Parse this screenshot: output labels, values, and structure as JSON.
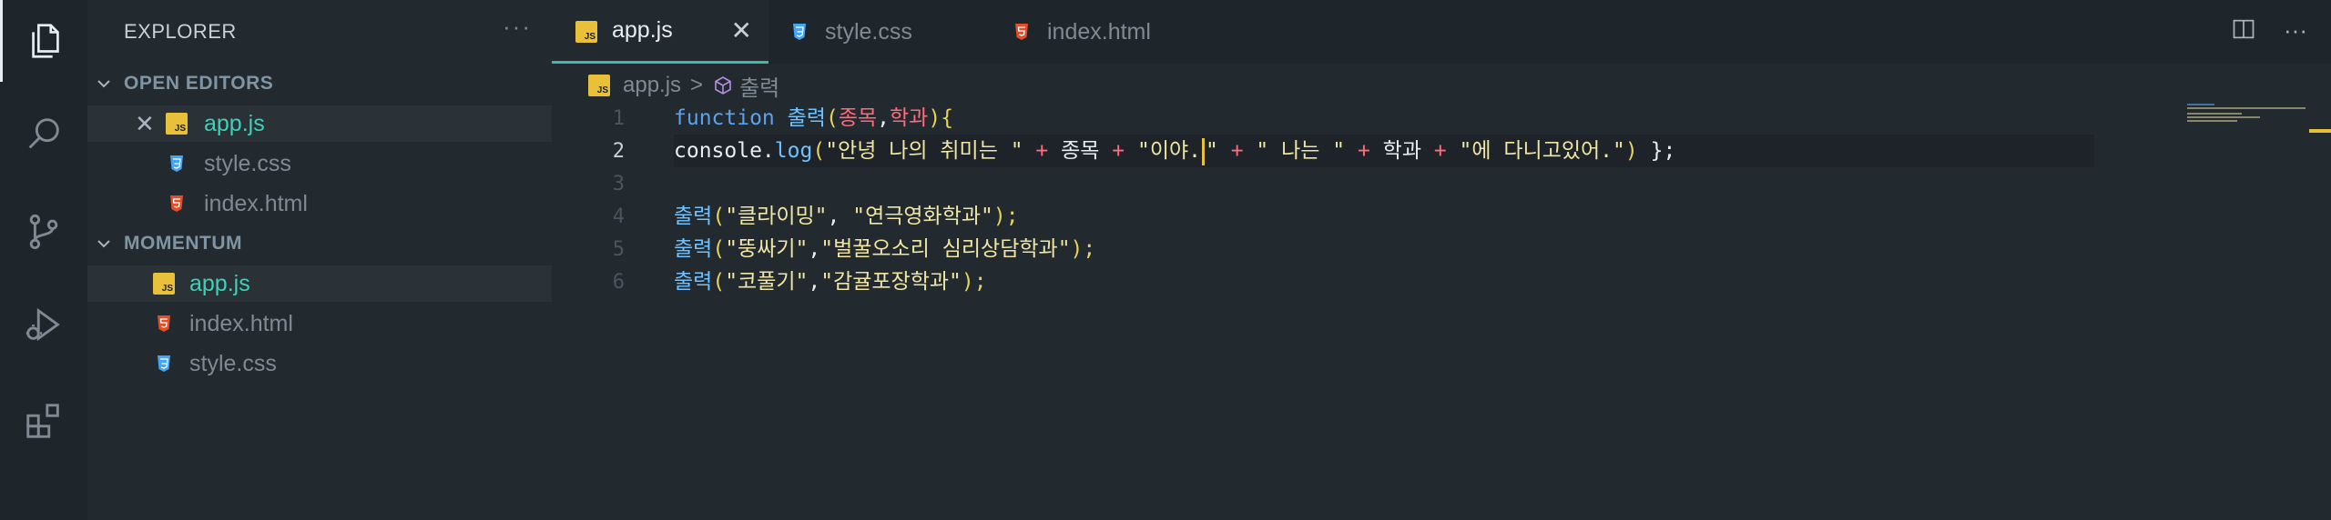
{
  "activity_bar": {
    "items": [
      "explorer-icon",
      "search-icon",
      "source-control-icon",
      "run-debug-icon",
      "extensions-icon"
    ]
  },
  "sidebar": {
    "title": "EXPLORER",
    "more": "···",
    "open_editors": {
      "title": "OPEN EDITORS",
      "files": [
        {
          "name": "app.js",
          "type": "js",
          "close": "✕"
        },
        {
          "name": "style.css",
          "type": "css"
        },
        {
          "name": "index.html",
          "type": "html"
        }
      ]
    },
    "project": {
      "title": "MOMENTUM",
      "files": [
        {
          "name": "app.js",
          "type": "js"
        },
        {
          "name": "index.html",
          "type": "html"
        },
        {
          "name": "style.css",
          "type": "css"
        }
      ]
    }
  },
  "tabs": [
    {
      "label": "app.js",
      "type": "js",
      "close": "✕"
    },
    {
      "label": "style.css",
      "type": "css"
    },
    {
      "label": "index.html",
      "type": "html"
    }
  ],
  "tab_actions": {
    "split": "split-editor-icon",
    "more": "···"
  },
  "breadcrumb": {
    "file": "app.js",
    "sep": ">",
    "symbol": "출력"
  },
  "editor": {
    "line_numbers": [
      "1",
      "2",
      "3",
      "4",
      "5",
      "6"
    ],
    "current_line": 2,
    "lines": [
      [
        "function",
        " ",
        "출력",
        "(",
        "종목",
        ",",
        "학과",
        "){"
      ],
      [
        "console.",
        "log",
        "(",
        "\"안녕 나의 취미는 \"",
        " + ",
        "종목",
        " + ",
        "\"이야.",
        "\"",
        " + ",
        "\" 나는 \"",
        " + ",
        "학과",
        " + ",
        "\"에 다니고있어.\"",
        ")",
        " };"
      ],
      [],
      [
        "출력",
        "(",
        "\"클라이밍\"",
        ", ",
        "\"연극영화학과\"",
        ");"
      ],
      [
        "출력",
        "(",
        "\"뚱싸기\"",
        ",",
        "\"벌꿀오소리 심리상담학과\"",
        ");"
      ],
      [
        "출력",
        "(",
        "\"코풀기\"",
        ",",
        "\"감귤포장학과\"",
        ");"
      ]
    ]
  },
  "colors": {
    "background": "#22292f",
    "activity_bar": "#1f262b",
    "accent": "#3fb8a8",
    "js_icon": "#e8c03a",
    "css_icon": "#42a5f5",
    "html_icon": "#e44d26"
  }
}
